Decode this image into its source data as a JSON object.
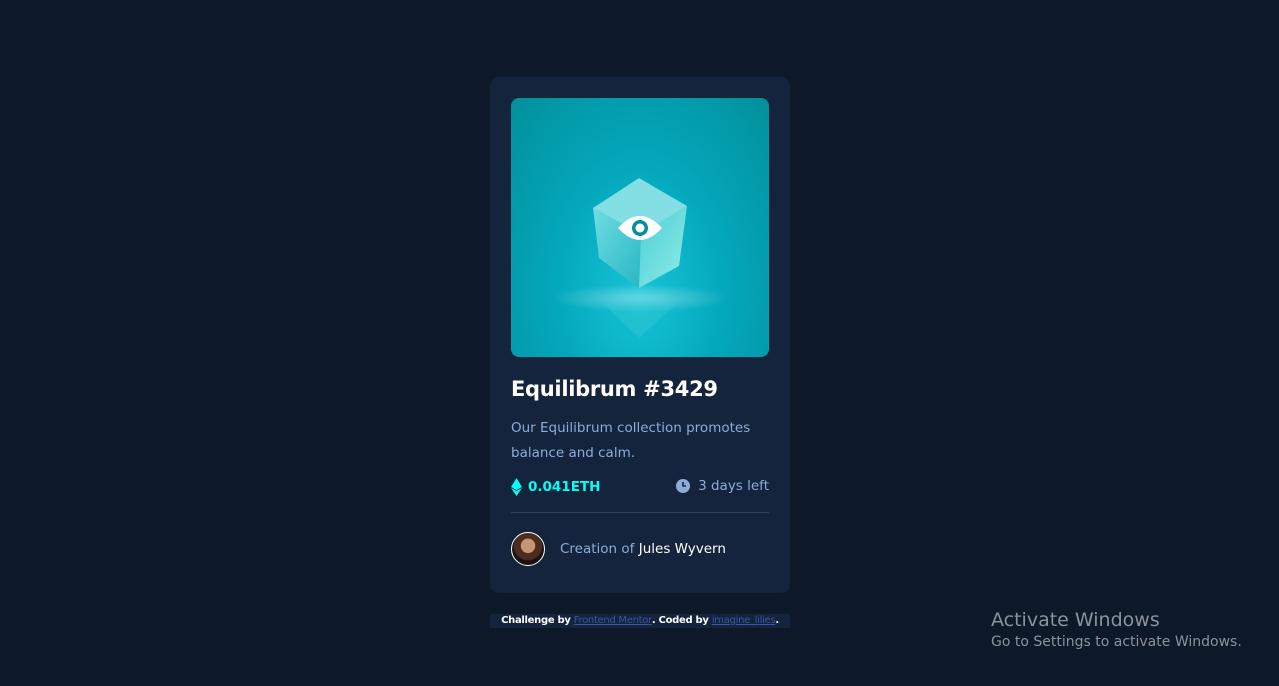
{
  "card": {
    "title": "Equilibrum #3429",
    "description": "Our Equilibrum collection promotes balance and calm.",
    "price": "0.041ETH",
    "time_left": "3 days left",
    "creator_prefix": "Creation of",
    "creator_name": "Jules Wyvern"
  },
  "attribution": {
    "prefix": "Challenge by",
    "link1": "Frontend Mentor",
    "middle": ". Coded by",
    "link2": "imagine_lilies",
    "suffix": "."
  },
  "watermark": {
    "title": "Activate Windows",
    "subtitle": "Go to Settings to activate Windows."
  },
  "colors": {
    "background": "#0d1829",
    "card": "#15243d",
    "accent_cyan": "#00fff8",
    "soft_blue": "#8bacd9",
    "white": "#ffffff"
  },
  "icons": [
    "view-eye-icon",
    "ethereum-icon",
    "clock-icon"
  ]
}
